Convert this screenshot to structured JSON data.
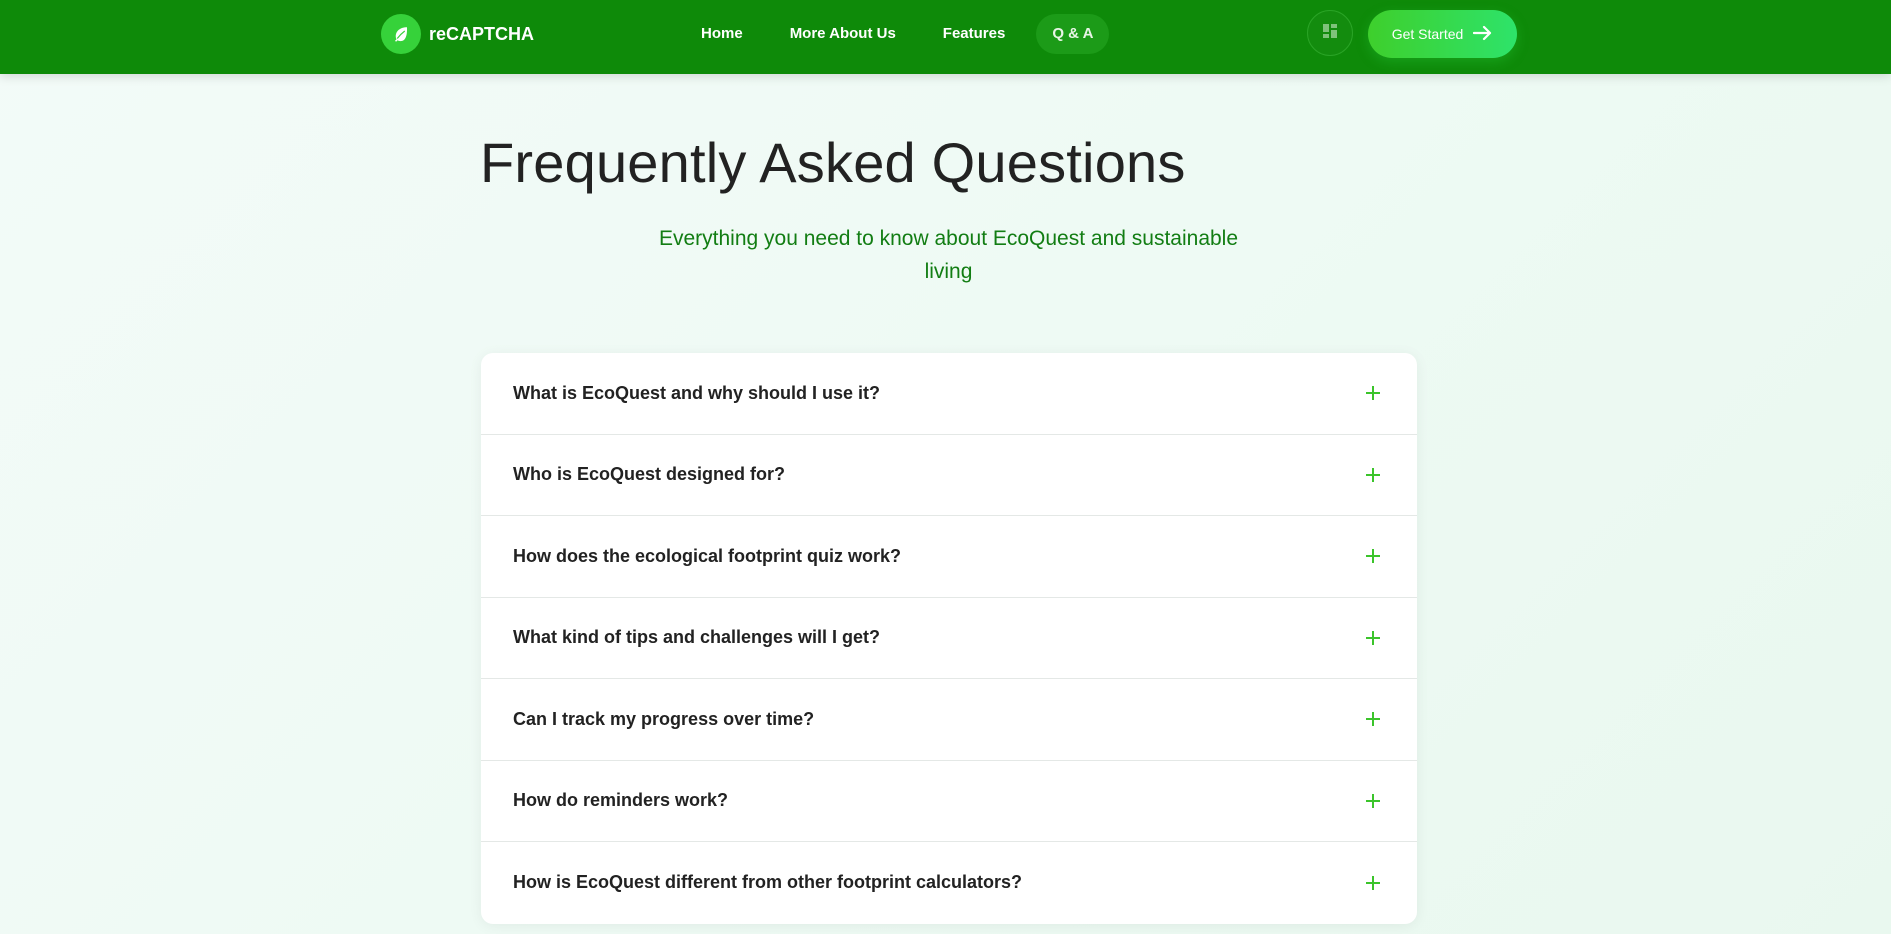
{
  "header": {
    "brand": "reCAPTCHA",
    "nav": [
      {
        "label": "Home"
      },
      {
        "label": "More About Us"
      },
      {
        "label": "Features"
      },
      {
        "label": "Q & A"
      }
    ],
    "active_nav": "Q & A",
    "dashboard_icon": "dashboard-icon",
    "cta_label": "Get Started",
    "cta_icon": "arrow-right-icon"
  },
  "main": {
    "title": "Frequently Asked Questions",
    "subtitle": "Everything you need to know about EcoQuest and sustainable living",
    "faqs": [
      {
        "question": "What is EcoQuest and why should I use it?"
      },
      {
        "question": "Who is EcoQuest designed for?"
      },
      {
        "question": "How does the ecological footprint quiz work?"
      },
      {
        "question": "What kind of tips and challenges will I get?"
      },
      {
        "question": "Can I track my progress over time?"
      },
      {
        "question": "How do reminders work?"
      },
      {
        "question": "How is EcoQuest different from other footprint calculators?"
      }
    ],
    "expand_icon": "plus-icon"
  },
  "colors": {
    "header_bg": "#0e8a09",
    "accent": "#36d23a",
    "subtitle": "#127d13",
    "plus": "#3bc42b"
  }
}
